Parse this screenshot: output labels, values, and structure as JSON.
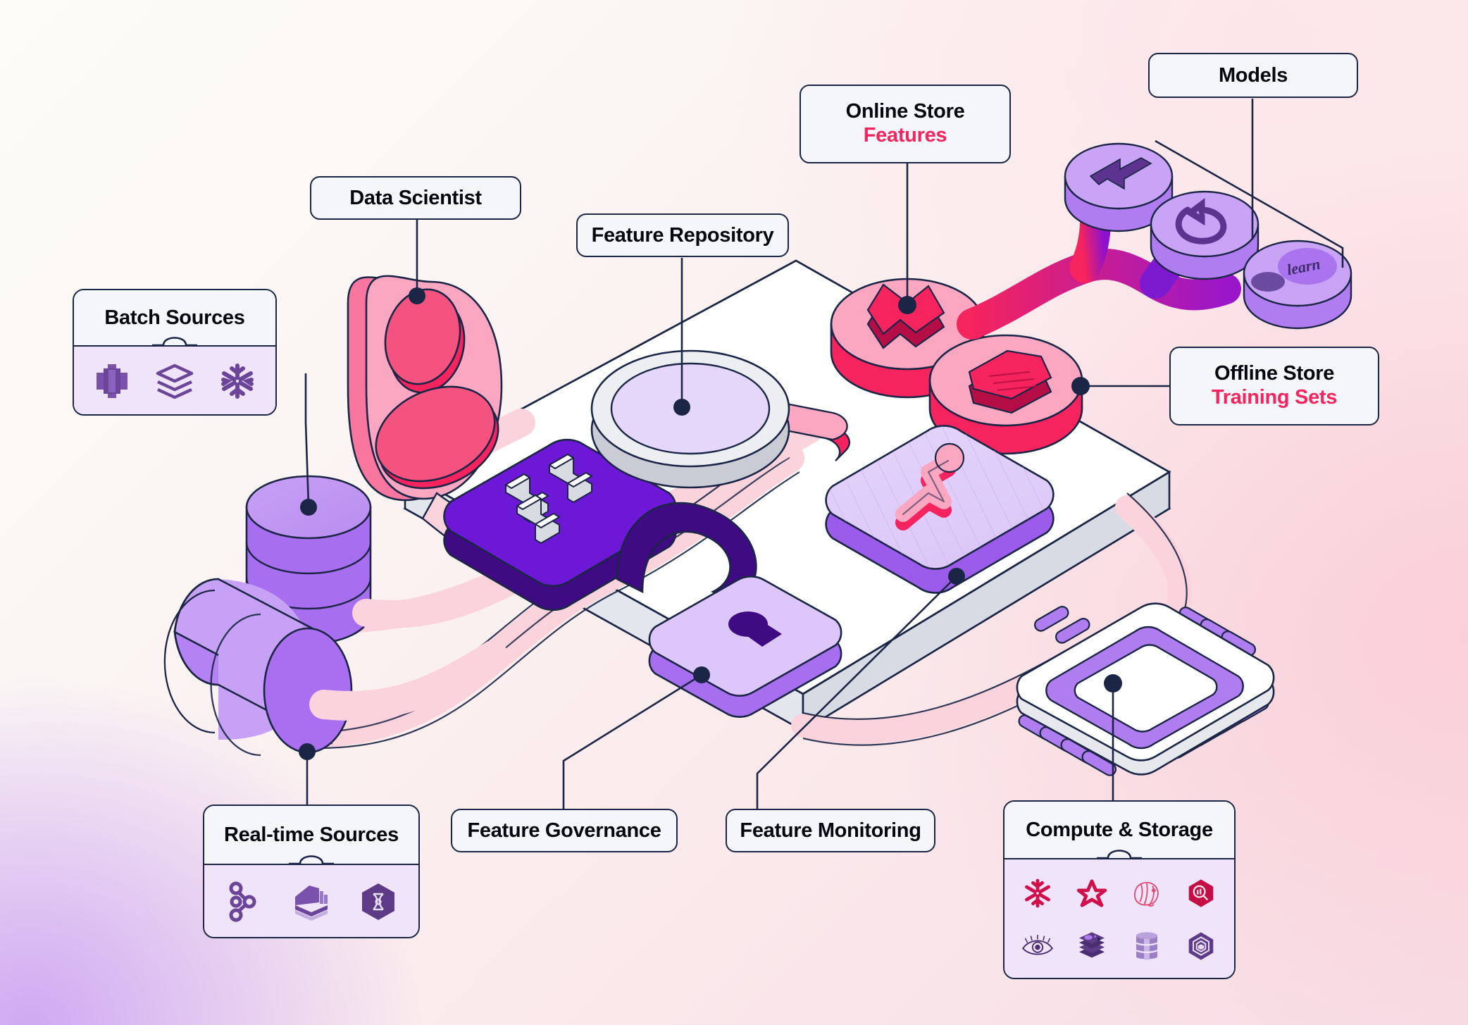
{
  "diagram": {
    "title": "Feature Store Platform Architecture",
    "type": "isometric-architecture"
  },
  "colors": {
    "accent_pink": "#f5235e",
    "accent_purple": "#6d18d6",
    "outline": "#1b2545",
    "panel_bg": "#f4f6f9",
    "icon_tray_bg": "#f0e4fb",
    "lavender": "#b07df0",
    "pink_disc": "#fa8fb4"
  },
  "callouts": [
    {
      "id": "data-scientist",
      "label": "Data Scientist"
    },
    {
      "id": "feature-repository",
      "label": "Feature Repository"
    },
    {
      "id": "online-store",
      "label": "Online Store",
      "sub": "Features"
    },
    {
      "id": "models",
      "label": "Models"
    },
    {
      "id": "offline-store",
      "label": "Offline Store",
      "sub": "Training Sets"
    },
    {
      "id": "feature-governance",
      "label": "Feature Governance"
    },
    {
      "id": "feature-monitoring",
      "label": "Feature Monitoring"
    }
  ],
  "panels": {
    "batch_sources": {
      "title": "Batch Sources",
      "icons": [
        {
          "name": "aws-s3-icon",
          "label": "AWS S3"
        },
        {
          "name": "databricks-icon",
          "label": "Databricks"
        },
        {
          "name": "snowflake-icon",
          "label": "Snowflake"
        }
      ]
    },
    "realtime_sources": {
      "title": "Real-time Sources",
      "icons": [
        {
          "name": "kafka-icon",
          "label": "Kafka"
        },
        {
          "name": "kinesis-icon",
          "label": "AWS Kinesis"
        },
        {
          "name": "hexagon-stream-icon",
          "label": "Stream Source"
        }
      ]
    },
    "compute_storage": {
      "title": "Compute & Storage",
      "icons": [
        {
          "name": "snowflake-icon",
          "label": "Snowflake"
        },
        {
          "name": "redis-star-icon",
          "label": "Redis"
        },
        {
          "name": "postgresql-icon",
          "label": "PostgreSQL"
        },
        {
          "name": "druid-icon",
          "label": "Druid"
        },
        {
          "name": "bigquery-eye-icon",
          "label": "BigQuery"
        },
        {
          "name": "redshift-icon",
          "label": "Redshift"
        },
        {
          "name": "dynamodb-icon",
          "label": "DynamoDB"
        },
        {
          "name": "hive-icon",
          "label": "Hive"
        }
      ]
    }
  },
  "platform_icons": [
    {
      "name": "sliders-settings-icon",
      "label": "Feature Engineering"
    },
    {
      "name": "magnifier-icon",
      "label": "Feature Repository"
    },
    {
      "name": "padlock-icon",
      "label": "Feature Governance"
    },
    {
      "name": "trend-chart-icon",
      "label": "Feature Monitoring"
    },
    {
      "name": "lightning-disc-icon",
      "label": "Online Store"
    },
    {
      "name": "document-disc-icon",
      "label": "Offline Store"
    },
    {
      "name": "cpu-chip-icon",
      "label": "Compute & Storage"
    },
    {
      "name": "user-avatar-icon",
      "label": "Data Scientist"
    }
  ],
  "model_discs": [
    {
      "name": "tensorflow-disc-icon",
      "label": "TensorFlow"
    },
    {
      "name": "pytorch-disc-icon",
      "label": "PyTorch"
    },
    {
      "name": "scikit-learn-disc-icon",
      "label": "scikit-learn",
      "text": "learn"
    }
  ],
  "data_stores": [
    {
      "name": "batch-database-cylinder",
      "label": "Batch Database"
    },
    {
      "name": "realtime-stream-cylinder",
      "label": "Real-time Stream"
    }
  ]
}
